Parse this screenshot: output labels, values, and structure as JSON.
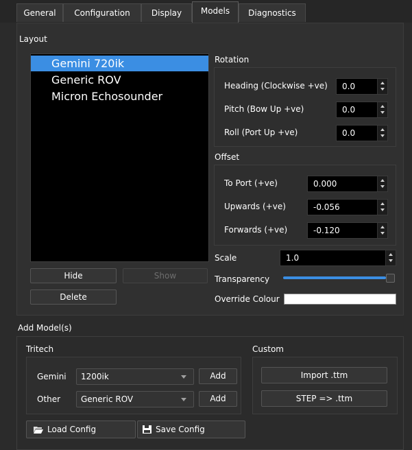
{
  "tabs": [
    {
      "label": "General"
    },
    {
      "label": "Configuration"
    },
    {
      "label": "Display"
    },
    {
      "label": "Models",
      "active": true
    },
    {
      "label": "Diagnostics"
    }
  ],
  "layout": {
    "title": "Layout",
    "models": [
      "Gemini 720ik",
      "Generic ROV",
      "Micron Echosounder"
    ],
    "selected_index": 0,
    "hide_label": "Hide",
    "show_label": "Show",
    "delete_label": "Delete"
  },
  "rotation": {
    "title": "Rotation",
    "heading_label": "Heading (Clockwise +ve)",
    "heading_value": "0.0",
    "pitch_label": "Pitch (Bow Up +ve)",
    "pitch_value": "0.0",
    "roll_label": "Roll (Port Up +ve)",
    "roll_value": "0.0"
  },
  "offset": {
    "title": "Offset",
    "port_label": "To Port (+ve)",
    "port_value": "0.000",
    "up_label": "Upwards (+ve)",
    "up_value": "-0.056",
    "fwd_label": "Forwards (+ve)",
    "fwd_value": "-0.120"
  },
  "scale": {
    "label": "Scale",
    "value": "1.0"
  },
  "transparency": {
    "label": "Transparency",
    "level": 0.98
  },
  "override": {
    "label": "Override Colour",
    "color": "#ffffff"
  },
  "add_models": {
    "title": "Add Model(s)",
    "tritech_title": "Tritech",
    "gemini_label": "Gemini",
    "gemini_value": "1200ik",
    "other_label": "Other",
    "other_value": "Generic ROV",
    "add_label": "Add",
    "custom_title": "Custom",
    "import_label": "Import .ttm",
    "step_label": "STEP => .ttm",
    "load_label": "Load Config",
    "save_label": "Save Config"
  },
  "colors": {
    "accent": "#3b8ee3",
    "background": "#2b2b2b",
    "list_bg": "#000000"
  },
  "icons": {
    "load": "folder-open-icon",
    "save": "floppy-disk-icon"
  }
}
